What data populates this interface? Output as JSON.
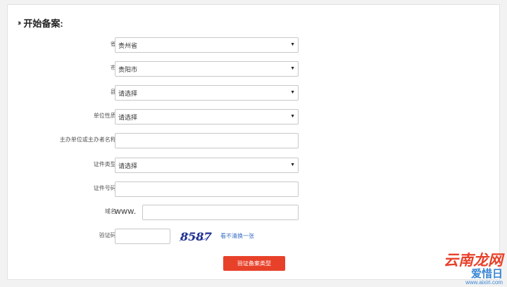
{
  "header": {
    "title": "开始备案:"
  },
  "form": {
    "province": {
      "label": "省:",
      "value": "贵州省"
    },
    "city": {
      "label": "市:",
      "value": "贵阳市"
    },
    "county": {
      "label": "县:",
      "value": "请选择"
    },
    "unit_nature": {
      "label": "单位性质:",
      "value": "请选择"
    },
    "sponsor_name": {
      "label": "主办单位或主办者名称:",
      "value": ""
    },
    "id_type": {
      "label": "证件类型:",
      "value": "请选择"
    },
    "id_number": {
      "label": "证件号码:",
      "value": ""
    },
    "domain": {
      "label": "域名:",
      "prefix": "www.",
      "value": ""
    },
    "captcha": {
      "label": "验证码:",
      "value": "",
      "image_text": "8587",
      "refresh_text": "看不清换一张"
    }
  },
  "submit_label": "验证备案类型",
  "watermark": {
    "main": "云南龙网",
    "sub_a": "爱惜日",
    "sub_b": "www.aixiri.com"
  },
  "colors": {
    "accent": "#e8412a",
    "link": "#3a6fc4"
  }
}
